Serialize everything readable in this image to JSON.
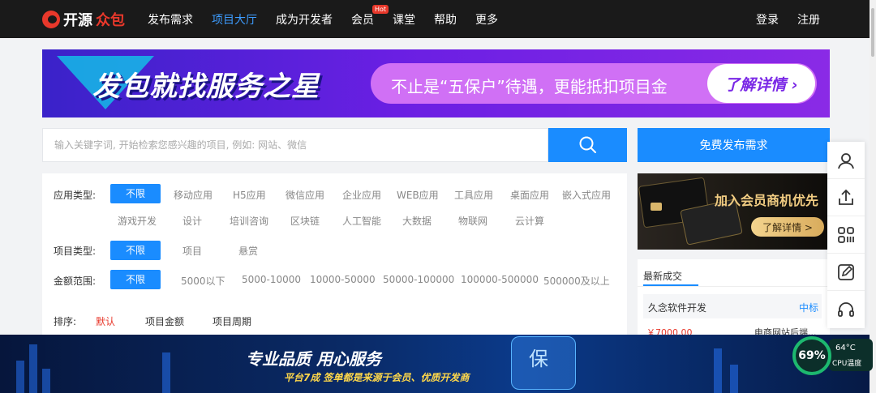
{
  "brand": {
    "name_part1": "开源",
    "name_part2": "众包"
  },
  "nav": {
    "items": [
      {
        "label": "发布需求"
      },
      {
        "label": "项目大厅"
      },
      {
        "label": "成为开发者"
      },
      {
        "label": "会员"
      },
      {
        "label": "课堂"
      },
      {
        "label": "帮助"
      },
      {
        "label": "更多"
      }
    ],
    "hot_badge": "Hot",
    "login": "登录",
    "register": "注册"
  },
  "banner": {
    "title": "发包就找服务之星",
    "subtitle": "不止是“五保户”待遇，更能抵扣项目金",
    "cta": "了解详情 ›"
  },
  "search": {
    "placeholder": "输入关键字词, 开始检索您感兴趣的项目, 例如: 网站、微信"
  },
  "publish_button": "免费发布需求",
  "filters": {
    "app_type": {
      "label": "应用类型:",
      "selected": "不限",
      "options": [
        "移动应用",
        "H5应用",
        "微信应用",
        "企业应用",
        "WEB应用",
        "工具应用",
        "桌面应用",
        "嵌入式应用",
        "游戏开发",
        "设计",
        "培训咨询",
        "区块链",
        "人工智能",
        "大数据",
        "物联网",
        "云计算"
      ]
    },
    "project_type": {
      "label": "项目类型:",
      "selected": "不限",
      "options": [
        "项目",
        "悬赏"
      ]
    },
    "amount_range": {
      "label": "金额范围:",
      "selected": "不限",
      "options": [
        "5000以下",
        "5000-10000",
        "10000-50000",
        "50000-100000",
        "100000-500000",
        "500000及以上"
      ]
    }
  },
  "sort": {
    "label": "排序:",
    "options": [
      "默认",
      "项目金额",
      "项目周期"
    ]
  },
  "member_ad": {
    "title": "加入会员商机优先",
    "cta": "了解详情 >"
  },
  "recent_deals": {
    "title": "最新成交",
    "items": [
      {
        "name": "久念软件开发",
        "status": "中标",
        "price": "￥7000.00",
        "project": "电商网站后端..."
      }
    ]
  },
  "bottom_ad": {
    "title": "专业品质 用心服务",
    "subtitle": "平台7成 签单都是来源于会员、优质开发商",
    "shield_char": "保"
  },
  "cpu_widget": {
    "percent": "69%",
    "temperature": "64°C",
    "label": "CPU温度"
  },
  "colors": {
    "accent": "#1a8cff",
    "nav_bg": "#1a1a1a",
    "brand_red": "#e8382b",
    "banner_purple": "#6a1fe3"
  }
}
